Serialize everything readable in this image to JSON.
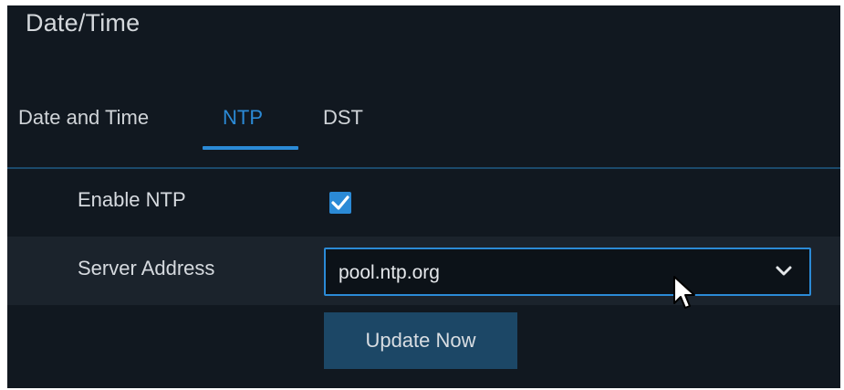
{
  "window": {
    "title": "Date/Time"
  },
  "tabs": [
    {
      "label": "Date and Time",
      "active": false
    },
    {
      "label": "NTP",
      "active": true
    },
    {
      "label": "DST",
      "active": false
    }
  ],
  "form": {
    "enable_ntp": {
      "label": "Enable NTP",
      "checked": true
    },
    "server_address": {
      "label": "Server Address",
      "value": "pool.ntp.org"
    },
    "update_button": {
      "label": "Update Now"
    }
  },
  "colors": {
    "accent": "#2b8ad6",
    "background": "#111820",
    "row_highlight": "#1b232c",
    "button": "#1c4766"
  },
  "icons": {
    "checkbox": "check-icon",
    "dropdown": "chevron-down-icon",
    "pointer": "mouse-pointer-icon"
  }
}
